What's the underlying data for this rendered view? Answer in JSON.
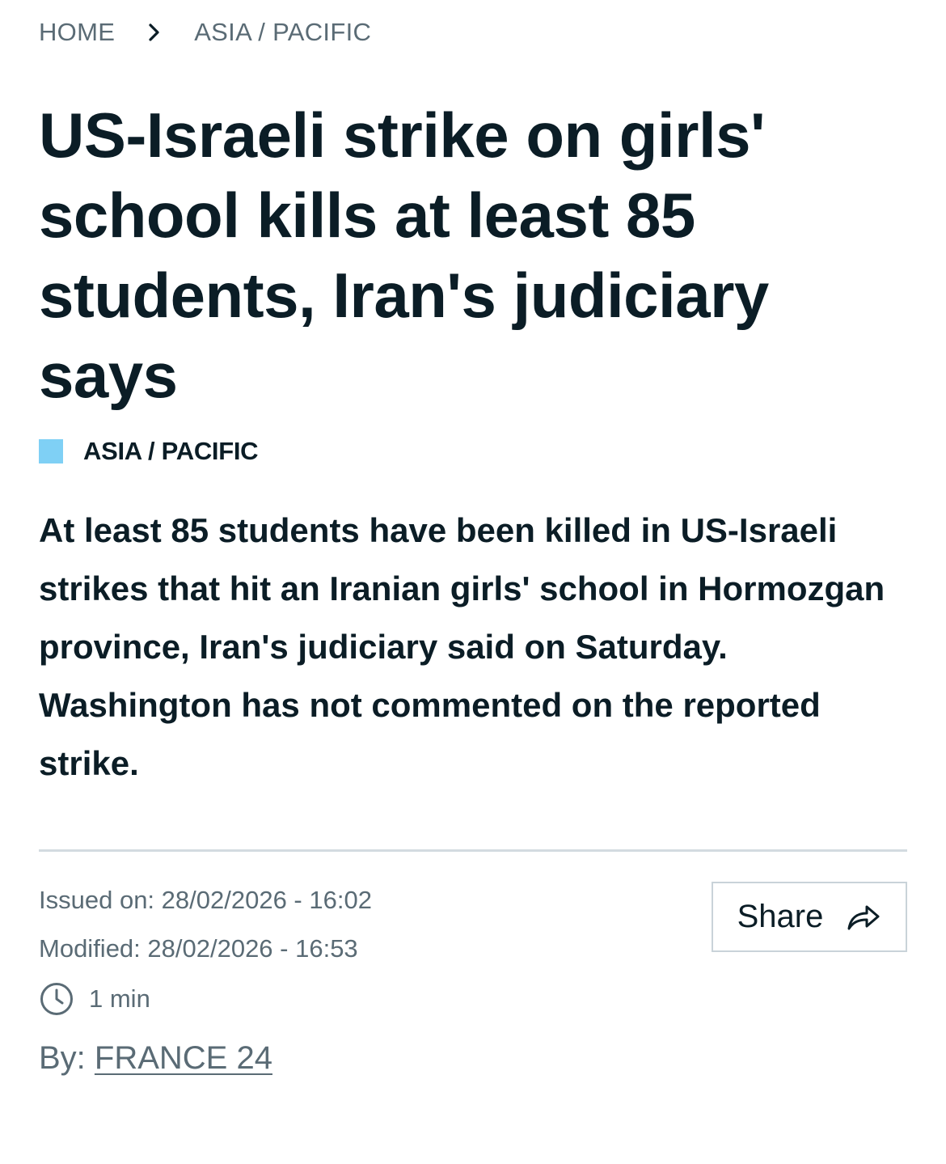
{
  "breadcrumb": {
    "home": "HOME",
    "section": "ASIA / PACIFIC"
  },
  "article": {
    "headline": "US-Israeli strike on girls' school kills at least 85 students, Iran's judiciary says",
    "category": "ASIA / PACIFIC",
    "category_color": "#7fd0f5",
    "lead": "At least 85 students have been killed in US-Israeli strikes that hit an Iranian girls' school in Hormozgan province, Iran's judiciary said on Saturday. Washington has not commented on the reported strike."
  },
  "meta": {
    "issued": "Issued on: 28/02/2026 - 16:02",
    "modified": "Modified: 28/02/2026 - 16:53",
    "read_time": "1 min",
    "read_time_icon": "clock-icon",
    "by_prefix": "By: ",
    "author": "FRANCE 24"
  },
  "share": {
    "label": "Share",
    "icon": "share-arrow-icon"
  }
}
